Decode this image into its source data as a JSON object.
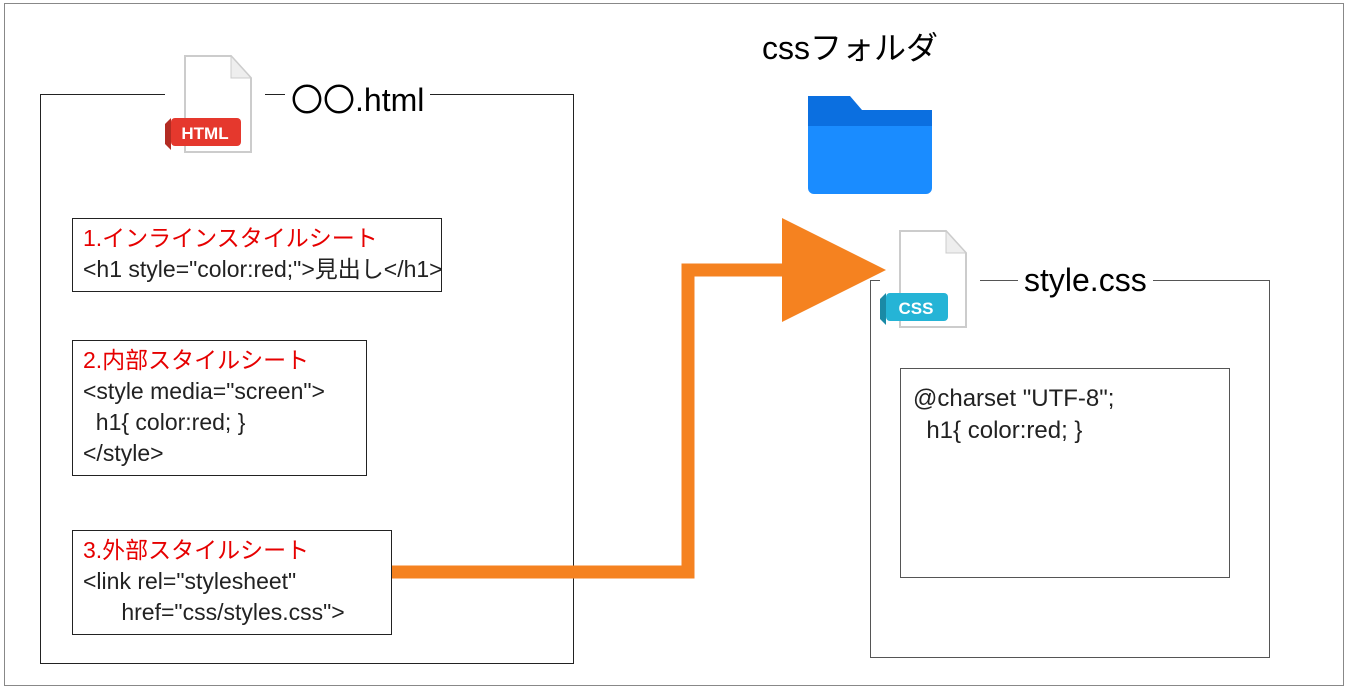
{
  "left": {
    "filename": "〇〇.html",
    "icon_badge": "HTML",
    "blocks": [
      {
        "title": "1.インラインスタイルシート",
        "code": "<h1 style=\"color:red;\">見出し</h1>"
      },
      {
        "title": "2.内部スタイルシート",
        "code": "<style media=\"screen\">\n  h1{ color:red; }\n</style>"
      },
      {
        "title": "3.外部スタイルシート",
        "code": "<link rel=\"stylesheet\"\n      href=\"css/styles.css\">"
      }
    ]
  },
  "right": {
    "folder_label": "cssフォルダ",
    "filename": "style.css",
    "icon_badge": "CSS",
    "content": "@charset \"UTF-8\";\n  h1{ color:red; }"
  }
}
